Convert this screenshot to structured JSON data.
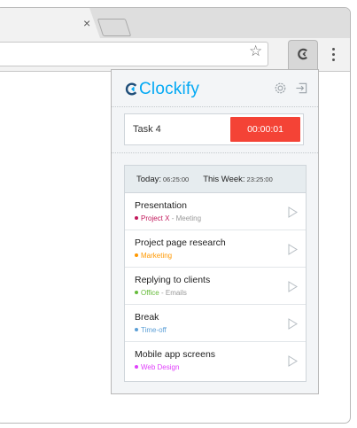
{
  "browser": {
    "tab_close_glyph": "×",
    "star_glyph": "☆"
  },
  "popup": {
    "brand": "Clockify",
    "brand_color": "#03a9f4",
    "header_icons": [
      "gear-icon",
      "logout-icon"
    ],
    "timer": {
      "task": "Task 4",
      "elapsed": "00:00:01",
      "button_color": "#f44336"
    },
    "totals": {
      "today_label": "Today:",
      "today_value": "06:25:00",
      "week_label": "This Week:",
      "week_value": "23:25:00"
    },
    "entries": [
      {
        "title": "Presentation",
        "project": "Project X",
        "detail": " - Meeting",
        "color": "#c2185b"
      },
      {
        "title": "Project page research",
        "project": "Marketing",
        "detail": "",
        "color": "#ff9800"
      },
      {
        "title": "Replying to clients",
        "project": "Office",
        "detail": " - Emails",
        "color": "#66bb3a"
      },
      {
        "title": "Break",
        "project": "Time-off",
        "detail": "",
        "color": "#5c9fd6"
      },
      {
        "title": "Mobile app screens",
        "project": "Web Design",
        "detail": "",
        "color": "#e040fb"
      }
    ]
  }
}
